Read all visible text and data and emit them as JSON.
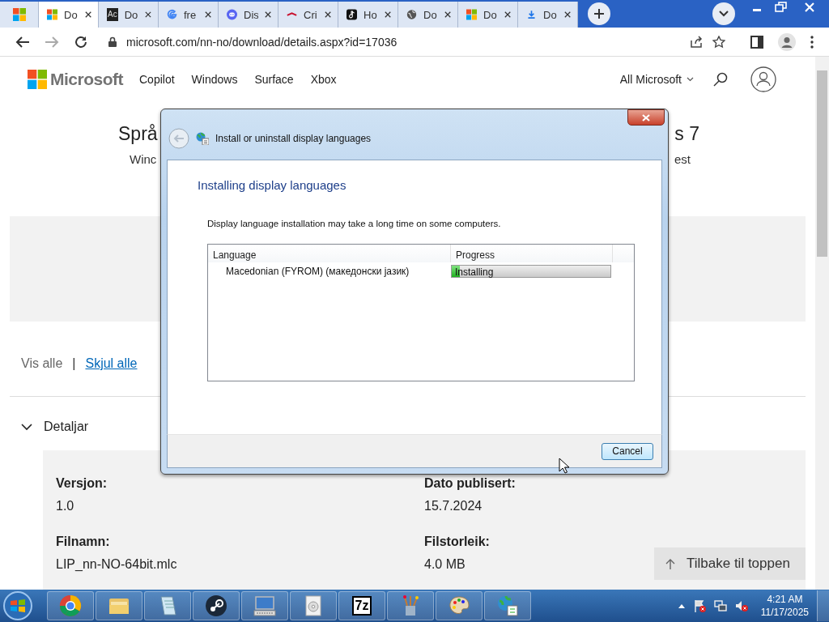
{
  "browser": {
    "tabs": [
      {
        "selected": false
      },
      {
        "label": "Do",
        "selected": true
      },
      {
        "icon_text": "Ac",
        "label": "Do",
        "selected": false
      },
      {
        "label": "fre",
        "selected": false
      },
      {
        "label": "Dis",
        "selected": false
      },
      {
        "label": "Cri",
        "selected": false
      },
      {
        "label": "Ho",
        "selected": false
      },
      {
        "label": "Do",
        "selected": false
      },
      {
        "label": "Do",
        "selected": false
      },
      {
        "label": "Do",
        "selected": false
      }
    ],
    "address": "microsoft.com/nn-no/download/details.aspx?id=17036"
  },
  "page": {
    "logo": "Microsoft",
    "nav": [
      "Copilot",
      "Windows",
      "Surface",
      "Xbox"
    ],
    "all_microsoft": "All Microsoft",
    "heading_left": "Språ",
    "heading_right": "s 7",
    "subtitle_left": "Winc",
    "subtitle_right": "est",
    "show_all": "Vis alle",
    "separator": "|",
    "hide_all": "Skjul alle",
    "details": {
      "title": "Detaljar",
      "expanded": true,
      "fields": [
        {
          "label": "Versjon:",
          "value": "1.0"
        },
        {
          "label": "Dato publisert:",
          "value": "15.7.2024"
        },
        {
          "label": "Filnamn:",
          "value": "LIP_nn-NO-64bit.mlc"
        },
        {
          "label": "Filstorleik:",
          "value": "4.0 MB"
        }
      ]
    },
    "back_to_top": "Tilbake til toppen"
  },
  "dialog": {
    "title": "Install or uninstall display languages",
    "heading": "Installing display languages",
    "note": "Display language installation may take a long time on some computers.",
    "columns": [
      "Language",
      "Progress"
    ],
    "rows": [
      {
        "language": "Macedonian (FYROM) (македонски јазик)",
        "status": "Installing",
        "level": 0.05
      }
    ],
    "button": "Cancel"
  },
  "taskbar": {
    "seven_zip_text": "7z",
    "time": "4:21 AM",
    "date": "11/17/2025"
  }
}
